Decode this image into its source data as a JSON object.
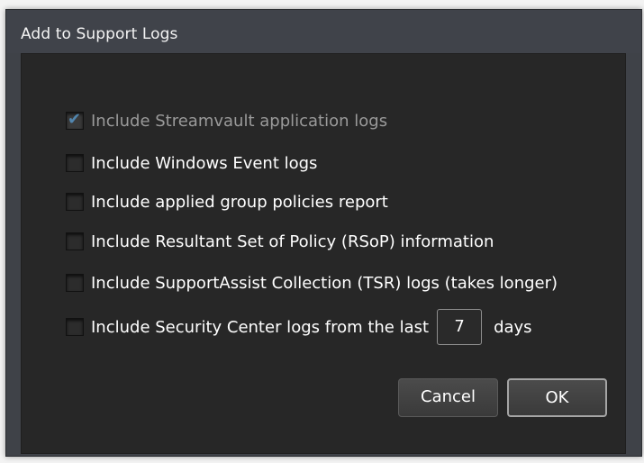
{
  "dialog": {
    "title": "Add to Support Logs"
  },
  "options": [
    {
      "label": "Include Streamvault application logs",
      "checked": true,
      "enabled": false
    },
    {
      "label": "Include Windows Event logs",
      "checked": false,
      "enabled": true
    },
    {
      "label": "Include applied group policies report",
      "checked": false,
      "enabled": true
    },
    {
      "label": "Include Resultant Set of Policy (RSoP) information",
      "checked": false,
      "enabled": true
    },
    {
      "label": "Include SupportAssist Collection (TSR) logs (takes longer)",
      "checked": false,
      "enabled": true
    },
    {
      "label": "Include Security Center logs from the last",
      "checked": false,
      "enabled": true
    }
  ],
  "days": {
    "value": "7",
    "suffix": "days"
  },
  "buttons": {
    "cancel": "Cancel",
    "ok": "OK"
  }
}
